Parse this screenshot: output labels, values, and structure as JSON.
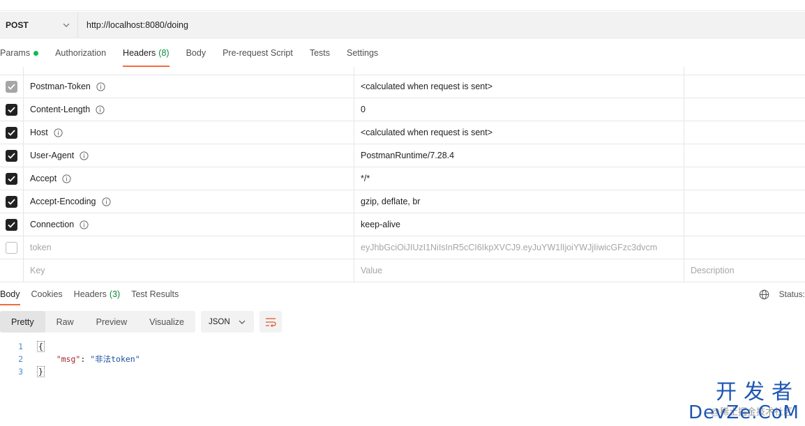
{
  "request": {
    "method": "POST",
    "url": "http://localhost:8080/doing"
  },
  "request_tabs": [
    {
      "label": "Params",
      "has_dot": true
    },
    {
      "label": "Authorization"
    },
    {
      "label": "Headers",
      "count": "(8)",
      "active": true
    },
    {
      "label": "Body"
    },
    {
      "label": "Pre-request Script"
    },
    {
      "label": "Tests"
    },
    {
      "label": "Settings"
    }
  ],
  "headers": [
    {
      "key": "Postman-Token",
      "value": "<calculated when request is sent>",
      "state": "disabled"
    },
    {
      "key": "Content-Length",
      "value": "0",
      "state": "checked"
    },
    {
      "key": "Host",
      "value": "<calculated when request is sent>",
      "state": "checked"
    },
    {
      "key": "User-Agent",
      "value": "PostmanRuntime/7.28.4",
      "state": "checked"
    },
    {
      "key": "Accept",
      "value": "*/*",
      "state": "checked"
    },
    {
      "key": "Accept-Encoding",
      "value": "gzip, deflate, br",
      "state": "checked"
    },
    {
      "key": "Connection",
      "value": "keep-alive",
      "state": "checked"
    },
    {
      "key": "token",
      "value": "eyJhbGciOiJIUzI1NiIsInR5cCI6IkpXVCJ9.eyJuYW1lIjoiYWJjIiwicGFzc3dvcm",
      "state": "unchecked"
    }
  ],
  "new_row": {
    "key_placeholder": "Key",
    "value_placeholder": "Value",
    "desc_placeholder": "Description"
  },
  "response_tabs": [
    {
      "label": "Body",
      "active": true
    },
    {
      "label": "Cookies"
    },
    {
      "label": "Headers",
      "count": "(3)"
    },
    {
      "label": "Test Results"
    }
  ],
  "status_label": "Status:",
  "view_modes": [
    "Pretty",
    "Raw",
    "Preview",
    "Visualize"
  ],
  "format": "JSON",
  "code": {
    "lines": [
      "1",
      "2",
      "3"
    ],
    "open": "{",
    "key": "\"msg\"",
    "colon": ": ",
    "value": "\"非法token\"",
    "close": "}"
  },
  "watermark": {
    "top": "开发者",
    "bottom": "DevZe.CoM",
    "small": "@稀土掘金技术社区"
  },
  "icons": {
    "method_chevron": "chevron-down-icon",
    "info": "info-icon",
    "globe": "globe-icon",
    "wrap": "wrap-lines-icon"
  },
  "colors": {
    "accent": "#f26b3a",
    "dot": "#0cbb52",
    "count": "#0a8a3a"
  }
}
